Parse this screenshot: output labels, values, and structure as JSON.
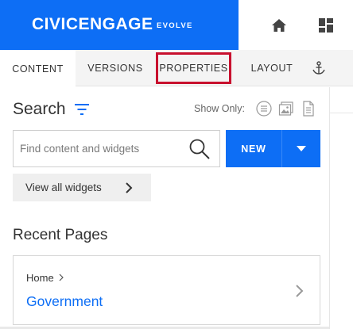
{
  "header": {
    "brand_name": "CIVICENGAGE",
    "brand_sub": "EVOLVE",
    "brand_color": "#0d6ef5",
    "icons": [
      "home-icon",
      "dashboard-icon"
    ]
  },
  "tabs": [
    {
      "label": "CONTENT",
      "active": true
    },
    {
      "label": "VERSIONS",
      "active": false
    },
    {
      "label": "PROPERTIES",
      "active": false,
      "highlighted": true
    },
    {
      "label": "LAYOUT",
      "active": false
    },
    {
      "icon": "anchor-icon"
    }
  ],
  "search": {
    "title": "Search",
    "show_only_label": "Show Only:",
    "show_only_icons": [
      "list-icon",
      "image-icon",
      "document-icon"
    ],
    "placeholder": "Find content and widgets",
    "value": ""
  },
  "new_button": {
    "label": "NEW"
  },
  "view_all": {
    "label": "View all widgets"
  },
  "recent": {
    "title": "Recent Pages",
    "items": [
      {
        "breadcrumb": "Home",
        "name": "Government"
      }
    ]
  },
  "colors": {
    "accent": "#0d6ef5",
    "highlight": "#c8102e"
  }
}
